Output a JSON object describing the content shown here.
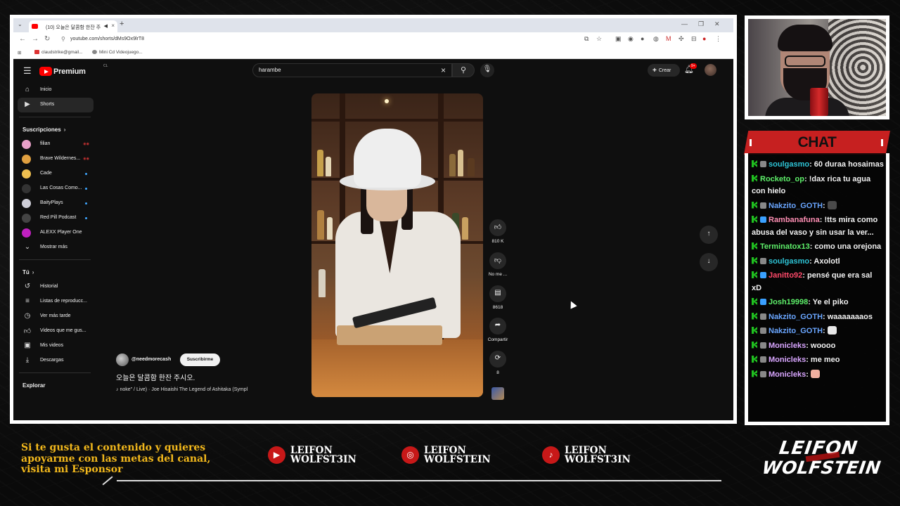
{
  "browser": {
    "tab_title": "(10) 오늘은 달콤함 한잔 주",
    "url": "youtube.com/shorts/dMs9Ox9lrT8",
    "bookmarks": [
      "claudstrike@gmail...",
      "Mini Cd Videojuego..."
    ]
  },
  "youtube": {
    "logo_text": "Premium",
    "logo_region": "CL",
    "search_query": "harambe",
    "create_label": "Crear",
    "notification_badge": "9+",
    "sidebar": {
      "top": [
        {
          "label": "Inicio",
          "icon": "home-icon"
        },
        {
          "label": "Shorts",
          "icon": "shorts-icon"
        }
      ],
      "subscriptions_header": "Suscripciones",
      "subscriptions": [
        {
          "label": "filian",
          "status": "live",
          "avatar_color": "#e8a0c8"
        },
        {
          "label": "Brave Wildernes...",
          "status": "live",
          "avatar_color": "#e0a040"
        },
        {
          "label": "Cade",
          "status": "new",
          "avatar_color": "#f0c050"
        },
        {
          "label": "Las Cosas Como...",
          "status": "new",
          "avatar_color": "#333333"
        },
        {
          "label": "BaityPlays",
          "status": "new",
          "avatar_color": "#cfcfd8"
        },
        {
          "label": "Red Pill Podcast",
          "status": "new",
          "avatar_color": "#444444"
        },
        {
          "label": "ALEXX Player One",
          "status": "none",
          "avatar_color": "#c020c0"
        }
      ],
      "show_more": "Mostrar más",
      "you_header": "Tú",
      "you_items": [
        {
          "label": "Historial",
          "icon": "history-icon"
        },
        {
          "label": "Listas de reproducc...",
          "icon": "playlist-icon"
        },
        {
          "label": "Ver más tarde",
          "icon": "clock-icon"
        },
        {
          "label": "Videos que me gus...",
          "icon": "like-icon"
        },
        {
          "label": "Mis videos",
          "icon": "my-videos-icon"
        },
        {
          "label": "Descargas",
          "icon": "download-icon"
        }
      ],
      "explore_header": "Explorar"
    },
    "short": {
      "channel": "@needmorecash",
      "subscribe_label": "Suscribirme",
      "title": "오늘은 달콤함 한잔 주시오.",
      "music": "♪ noke\" / Live) · Joe Hisaishi    The Legend of Ashitaka (Sympl",
      "likes": "810 K",
      "dislike_label": "No me ...",
      "comments": "8618",
      "share_label": "Compartir",
      "remix_count": "8"
    }
  },
  "chat": {
    "header": "CHAT",
    "messages": [
      {
        "user": "soulgasmo",
        "color": "#2ec4d6",
        "badge": "#888888",
        "text": ": 60 duraa hosaimas"
      },
      {
        "user": "Rocketo_op",
        "color": "#5ef06a",
        "badge": "",
        "text": ": !dax rica tu agua con hielo"
      },
      {
        "user": "Nakzito_GOTH",
        "color": "#6aa6ff",
        "badge": "#888888",
        "text": ": ",
        "emote": "#4a4a4a"
      },
      {
        "user": "Rambanafuna",
        "color": "#ff8fb4",
        "badge": "#3aa0ff",
        "text": ": !tts mira como abusa del vaso y sin usar la ver..."
      },
      {
        "user": "Terminatox13",
        "color": "#5ef06a",
        "badge": "",
        "text": ": como una orejona"
      },
      {
        "user": "soulgasmo",
        "color": "#2ec4d6",
        "badge": "#888888",
        "text": ": Axolotl"
      },
      {
        "user": "Janitto92",
        "color": "#ff4a6a",
        "badge": "#3aa0ff",
        "text": ": pensé que era sal xD"
      },
      {
        "user": "Josh19998",
        "color": "#5ef06a",
        "badge": "#3aa0ff",
        "text": ": Ye el piko"
      },
      {
        "user": "Nakzito_GOTH",
        "color": "#6aa6ff",
        "badge": "#888888",
        "text": ": waaaaaaaos"
      },
      {
        "user": "Nakzito_GOTH",
        "color": "#6aa6ff",
        "badge": "#888888",
        "text": ": ",
        "emote": "#e8e8e8"
      },
      {
        "user": "Monicleks",
        "color": "#d9a6ff",
        "badge": "#888888",
        "text": ": woooo"
      },
      {
        "user": "Monicleks",
        "color": "#d9a6ff",
        "badge": "#888888",
        "text": ": me meo"
      },
      {
        "user": "Monicleks",
        "color": "#d9a6ff",
        "badge": "#888888",
        "text": ": ",
        "emote": "#f0b0a0"
      }
    ]
  },
  "overlay": {
    "promo_text": "Si te gusta el contenido y quieres apoyarme con las metas del canal, visita mi Esponsor",
    "socials": [
      {
        "platform": "youtube-icon",
        "name": "LEIFON\nWOLFST3IN"
      },
      {
        "platform": "instagram-icon",
        "name": "LEIFON\nWOLFSTEIN"
      },
      {
        "platform": "tiktok-icon",
        "name": "LEIFON\nWOLFST3IN"
      }
    ],
    "brand_line1": "LEIFON",
    "brand_line2": "WOLFSTEIN"
  }
}
